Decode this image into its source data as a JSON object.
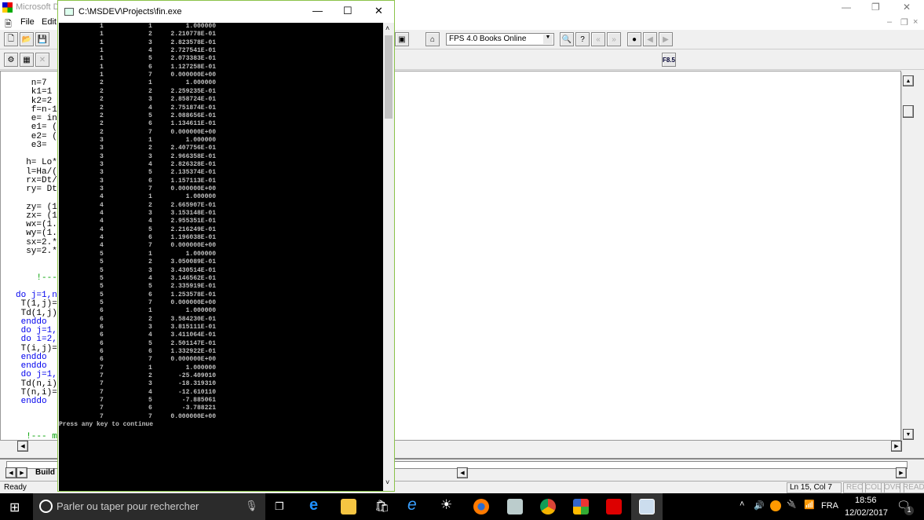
{
  "app": {
    "title": "Microsoft D",
    "menu": [
      "File",
      "Edit"
    ]
  },
  "toolbar": {
    "books_combo": "FPS 4.0 Books Online",
    "f85_label": "F8.5"
  },
  "editor": {
    "lines": [
      {
        "t": "   n=7",
        "k": ""
      },
      {
        "t": "   k1=1",
        "k": ""
      },
      {
        "t": "   k2=2",
        "k": ""
      },
      {
        "t": "   f=n-1",
        "k": ""
      },
      {
        "t": "   e= in",
        "k": "in"
      },
      {
        "t": "   e1= (",
        "k": ""
      },
      {
        "t": "   e2= (",
        "k": ""
      },
      {
        "t": "   e3=",
        "k": ""
      },
      {
        "t": "",
        "k": ""
      },
      {
        "t": "  h= Lo*",
        "k": ""
      },
      {
        "t": "  l=Ha/(",
        "k": ""
      },
      {
        "t": "  rx=Dt/",
        "k": ""
      },
      {
        "t": "  ry= Dt",
        "k": ""
      },
      {
        "t": "",
        "k": ""
      },
      {
        "t": "  zy= (1",
        "k": ""
      },
      {
        "t": "  zx= (1",
        "k": ""
      },
      {
        "t": "  wx=(1.",
        "k": ""
      },
      {
        "t": "  wy=(1.",
        "k": ""
      },
      {
        "t": "  sx=2.*",
        "k": ""
      },
      {
        "t": "  sy=2.*",
        "k": ""
      },
      {
        "t": "",
        "k": ""
      },
      {
        "t": "",
        "k": ""
      },
      {
        "t": "    !---",
        "k": "cm"
      },
      {
        "t": "",
        "k": ""
      },
      {
        "t": "do j=1,n",
        "k": "do"
      },
      {
        "t": " T(1,j)=",
        "k": ""
      },
      {
        "t": " Td(1,j)",
        "k": ""
      },
      {
        "t": " enddo",
        "k": "kw"
      },
      {
        "t": " do j=1,",
        "k": "do"
      },
      {
        "t": " do i=2,",
        "k": "do"
      },
      {
        "t": " T(i,j)=",
        "k": ""
      },
      {
        "t": " enddo",
        "k": "kw"
      },
      {
        "t": " enddo",
        "k": "kw"
      },
      {
        "t": " do j=1,",
        "k": "do"
      },
      {
        "t": " Td(n,i)",
        "k": ""
      },
      {
        "t": " T(n,i)=",
        "k": ""
      },
      {
        "t": " enddo",
        "k": "kw"
      },
      {
        "t": "",
        "k": ""
      },
      {
        "t": "",
        "k": ""
      },
      {
        "t": "",
        "k": ""
      },
      {
        "t": "  !--- ma",
        "k": "cm"
      }
    ]
  },
  "output_tabs": {
    "build": "Build"
  },
  "status": {
    "ready": "Ready",
    "position": "Ln 15, Col 7",
    "rec": "REC",
    "col": "COL",
    "ovr": "OVR",
    "read": "READ"
  },
  "console": {
    "title": "C:\\MSDEV\\Projects\\fin.exe",
    "rows": [
      [
        "1",
        "1",
        "1.000000"
      ],
      [
        "1",
        "2",
        "2.210778E-01"
      ],
      [
        "1",
        "3",
        "2.823578E-01"
      ],
      [
        "1",
        "4",
        "2.727541E-01"
      ],
      [
        "1",
        "5",
        "2.073383E-01"
      ],
      [
        "1",
        "6",
        "1.127258E-01"
      ],
      [
        "1",
        "7",
        "0.000000E+00"
      ],
      [
        "2",
        "1",
        "1.000000"
      ],
      [
        "2",
        "2",
        "2.259235E-01"
      ],
      [
        "2",
        "3",
        "2.858724E-01"
      ],
      [
        "2",
        "4",
        "2.751874E-01"
      ],
      [
        "2",
        "5",
        "2.088656E-01"
      ],
      [
        "2",
        "6",
        "1.134611E-01"
      ],
      [
        "2",
        "7",
        "0.000000E+00"
      ],
      [
        "3",
        "1",
        "1.000000"
      ],
      [
        "3",
        "2",
        "2.407756E-01"
      ],
      [
        "3",
        "3",
        "2.966358E-01"
      ],
      [
        "3",
        "4",
        "2.826328E-01"
      ],
      [
        "3",
        "5",
        "2.135374E-01"
      ],
      [
        "3",
        "6",
        "1.157113E-01"
      ],
      [
        "3",
        "7",
        "0.000000E+00"
      ],
      [
        "4",
        "1",
        "1.000000"
      ],
      [
        "4",
        "2",
        "2.665907E-01"
      ],
      [
        "4",
        "3",
        "3.153148E-01"
      ],
      [
        "4",
        "4",
        "2.955351E-01"
      ],
      [
        "4",
        "5",
        "2.216249E-01"
      ],
      [
        "4",
        "6",
        "1.196038E-01"
      ],
      [
        "4",
        "7",
        "0.000000E+00"
      ],
      [
        "5",
        "1",
        "1.000000"
      ],
      [
        "5",
        "2",
        "3.050089E-01"
      ],
      [
        "5",
        "3",
        "3.430514E-01"
      ],
      [
        "5",
        "4",
        "3.146562E-01"
      ],
      [
        "5",
        "5",
        "2.335919E-01"
      ],
      [
        "5",
        "6",
        "1.253578E-01"
      ],
      [
        "5",
        "7",
        "0.000000E+00"
      ],
      [
        "6",
        "1",
        "1.000000"
      ],
      [
        "6",
        "2",
        "3.584230E-01"
      ],
      [
        "6",
        "3",
        "3.815111E-01"
      ],
      [
        "6",
        "4",
        "3.411064E-01"
      ],
      [
        "6",
        "5",
        "2.501147E-01"
      ],
      [
        "6",
        "6",
        "1.332922E-01"
      ],
      [
        "6",
        "7",
        "0.000000E+00"
      ],
      [
        "7",
        "1",
        "1.000000"
      ],
      [
        "7",
        "2",
        "-25.409010"
      ],
      [
        "7",
        "3",
        "-18.319310"
      ],
      [
        "7",
        "4",
        "-12.610110"
      ],
      [
        "7",
        "5",
        "-7.885061"
      ],
      [
        "7",
        "6",
        "-3.788221"
      ],
      [
        "7",
        "7",
        "0.000000E+00"
      ]
    ],
    "prompt": "Press any key to continue"
  },
  "taskbar": {
    "search_placeholder": "Parler ou taper pour rechercher",
    "lang": "FRA",
    "time": "18:56",
    "date": "12/02/2017",
    "notif_count": "1"
  }
}
